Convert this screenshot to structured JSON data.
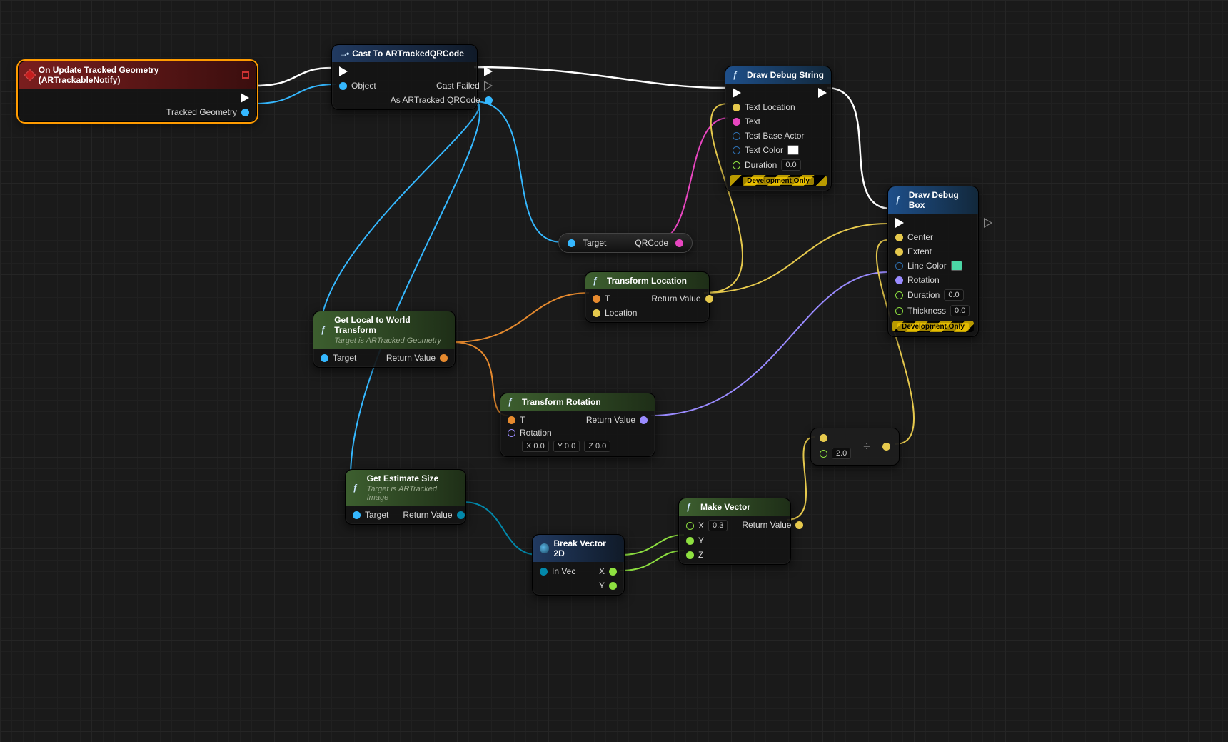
{
  "nodes": {
    "event": {
      "title": "On Update Tracked Geometry (ARTrackableNotify)",
      "out_data": "Tracked Geometry"
    },
    "cast": {
      "title": "Cast To ARTrackedQRCode",
      "in_obj": "Object",
      "out_fail": "Cast Failed",
      "out_as": "As ARTracked QRCode"
    },
    "qrcode": {
      "target": "Target",
      "out": "QRCode"
    },
    "localworld": {
      "title": "Get Local to World Transform",
      "subtitle": "Target is ARTracked Geometry",
      "in": "Target",
      "out": "Return Value"
    },
    "tloc": {
      "title": "Transform Location",
      "t": "T",
      "loc": "Location",
      "out": "Return Value"
    },
    "trot": {
      "title": "Transform Rotation",
      "t": "T",
      "rot": "Rotation",
      "out": "Return Value",
      "x": "0.0",
      "y": "0.0",
      "z": "0.0"
    },
    "estsize": {
      "title": "Get Estimate Size",
      "subtitle": "Target is ARTracked Image",
      "in": "Target",
      "out": "Return Value"
    },
    "brkvec": {
      "title": "Break Vector 2D",
      "in": "In Vec",
      "x": "X",
      "y": "Y"
    },
    "mkvec": {
      "title": "Make Vector",
      "x": "0.3",
      "yl": "Y",
      "zl": "Z",
      "xl": "X",
      "out": "Return Value"
    },
    "divide": {
      "b": "2.0"
    },
    "dbgstr": {
      "title": "Draw Debug String",
      "p1": "Text Location",
      "p2": "Text",
      "p3": "Test Base Actor",
      "p4": "Text Color",
      "p5": "Duration",
      "dur": "0.0",
      "dev": "Development Only"
    },
    "dbgbox": {
      "title": "Draw Debug Box",
      "p1": "Center",
      "p2": "Extent",
      "p3": "Line Color",
      "p4": "Rotation",
      "p5": "Duration",
      "p6": "Thickness",
      "dur": "0.0",
      "thk": "0.0",
      "dev": "Development Only"
    }
  },
  "colors": {
    "textcolor": "#ffffff",
    "linecolor": "#4bd6a5"
  }
}
